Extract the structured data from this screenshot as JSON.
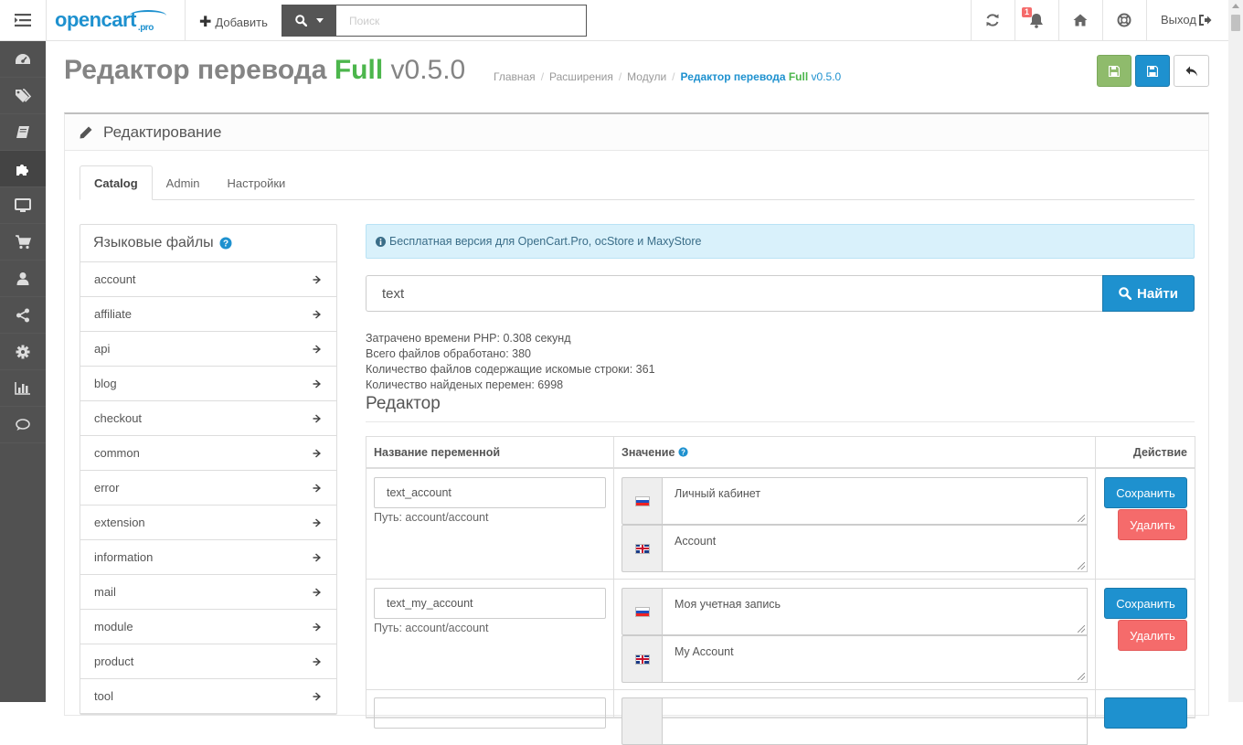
{
  "header": {
    "logo_text": "opencart",
    "logo_suffix": ".pro",
    "add_label": "Добавить",
    "search_placeholder": "Поиск",
    "notification_count": "1",
    "logout_label": "Выход"
  },
  "sidebar": {
    "items": [
      {
        "icon": "dashboard-icon"
      },
      {
        "icon": "tags-icon"
      },
      {
        "icon": "book-icon"
      },
      {
        "icon": "puzzle-icon",
        "active": true
      },
      {
        "icon": "desktop-icon"
      },
      {
        "icon": "cart-icon"
      },
      {
        "icon": "user-icon"
      },
      {
        "icon": "share-icon"
      },
      {
        "icon": "gear-icon"
      },
      {
        "icon": "bar-chart-icon"
      },
      {
        "icon": "comment-icon"
      }
    ]
  },
  "page": {
    "title_main": "Редактор перевода",
    "title_full": "Full",
    "title_version": "v0.5.0",
    "breadcrumb": {
      "home": "Главная",
      "extensions": "Расширения",
      "modules": "Модули",
      "current_main": "Редактор перевода",
      "current_full": "Full",
      "current_version": "v0.5.0"
    }
  },
  "panel": {
    "heading": "Редактирование"
  },
  "tabs": [
    "Catalog",
    "Admin",
    "Настройки"
  ],
  "lang_files": {
    "title": "Языковые файлы",
    "items": [
      "account",
      "affiliate",
      "api",
      "blog",
      "checkout",
      "common",
      "error",
      "extension",
      "information",
      "mail",
      "module",
      "product",
      "tool"
    ]
  },
  "info_alert": "Бесплатная версия для OpenCart.Pro, ocStore и MaxyStore",
  "search": {
    "value": "text",
    "button_label": "Найти"
  },
  "stats": {
    "time": "Затрачено времени PHP: 0.308 секунд",
    "files_processed": "Всего файлов обработано: 380",
    "files_matching": "Количество файлов содержащие искомые строки: 361",
    "vars_found": "Количество найденых перемен: 6998"
  },
  "editor": {
    "title": "Редактор",
    "col_name": "Название переменной",
    "col_value": "Значение",
    "col_action": "Действие",
    "save_label": "Сохранить",
    "delete_label": "Удалить",
    "rows": [
      {
        "var": "text_account",
        "path": "Путь: account/account",
        "ru": "Личный кабинет",
        "en": "Account"
      },
      {
        "var": "text_my_account",
        "path": "Путь: account/account",
        "ru": "Моя учетная запись",
        "en": "My Account"
      }
    ]
  },
  "colors": {
    "primary": "#1e91cf",
    "success": "#4cb64c",
    "danger": "#f56b6b",
    "sidebar": "#515151"
  }
}
